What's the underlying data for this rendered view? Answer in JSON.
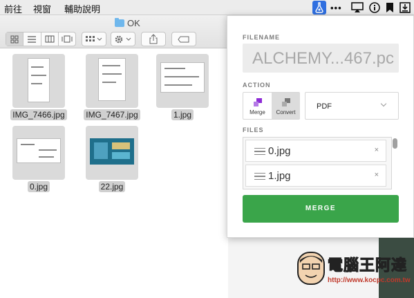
{
  "menubar": {
    "items": [
      "前往",
      "視窗",
      "輔助說明"
    ],
    "tray_icons": [
      "alchemy-app-icon",
      "more-dots-icon",
      "airplay-icon",
      "info-icon",
      "bookmark-icon",
      "download-icon"
    ],
    "dots": "•••"
  },
  "finder": {
    "window_title": "OK",
    "toolbar_icons": [
      "icon-view-icon",
      "list-view-icon",
      "column-view-icon",
      "gallery-view-icon",
      "group-icon",
      "gear-icon",
      "share-icon",
      "tag-icon"
    ],
    "files": [
      {
        "name": "IMG_7466.jpg"
      },
      {
        "name": "IMG_7467.jpg"
      },
      {
        "name": "1.jpg"
      },
      {
        "name": "0.jpg"
      },
      {
        "name": "22.jpg"
      }
    ]
  },
  "panel": {
    "filename_label": "FILENAME",
    "filename_value": "ALCHEMY...467.pc",
    "action_label": "ACTION",
    "actions": [
      {
        "label": "Merge",
        "selected": false
      },
      {
        "label": "Convert",
        "selected": true
      }
    ],
    "format_value": "PDF",
    "files_label": "FILES",
    "files": [
      {
        "name": "0.jpg",
        "remove": "×"
      },
      {
        "name": "1.jpg",
        "remove": "×"
      }
    ],
    "merge_button": "MERGE",
    "colors": {
      "merge_button": "#3aa54a",
      "merge_icon": "#8e2bd6"
    }
  },
  "watermark": {
    "brand": "電腦王阿達",
    "url": "http://www.kocpc.com.tw"
  }
}
